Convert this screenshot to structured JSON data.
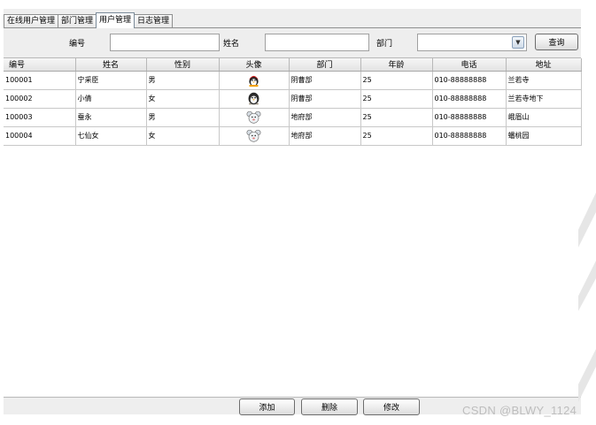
{
  "tabs": [
    {
      "label": "在线用户管理"
    },
    {
      "label": "部门管理"
    },
    {
      "label": "用户管理",
      "active": true
    },
    {
      "label": "日志管理"
    }
  ],
  "search": {
    "id_label": "编号",
    "id_value": "",
    "name_label": "姓名",
    "name_value": "",
    "dept_label": "部门",
    "dept_value": "",
    "query_button": "查询"
  },
  "table": {
    "columns": [
      "编号",
      "姓名",
      "性别",
      "头像",
      "部门",
      "年龄",
      "电话",
      "地址"
    ],
    "rows": [
      {
        "id": "100001",
        "name": "宁采臣",
        "gender": "男",
        "avatar_icon": "qq-penguin-red-hat-icon",
        "dept": "阴曹部",
        "age": "25",
        "phone": "010-88888888",
        "address": "兰若寺"
      },
      {
        "id": "100002",
        "name": "小倩",
        "gender": "女",
        "avatar_icon": "qq-penguin-dark-icon",
        "dept": "阴曹部",
        "age": "25",
        "phone": "010-88888888",
        "address": "兰若寺地下"
      },
      {
        "id": "100003",
        "name": "蚕永",
        "gender": "男",
        "avatar_icon": "cartoon-mouse-icon",
        "dept": "地府部",
        "age": "25",
        "phone": "010-88888888",
        "address": "峨眉山"
      },
      {
        "id": "100004",
        "name": "七仙女",
        "gender": "女",
        "avatar_icon": "cartoon-mouse-icon",
        "dept": "地府部",
        "age": "25",
        "phone": "010-88888888",
        "address": "蟠桃园"
      }
    ]
  },
  "actions": {
    "add": "添加",
    "delete": "删除",
    "modify": "修改"
  },
  "watermark": "CSDN @BLWY_1124"
}
